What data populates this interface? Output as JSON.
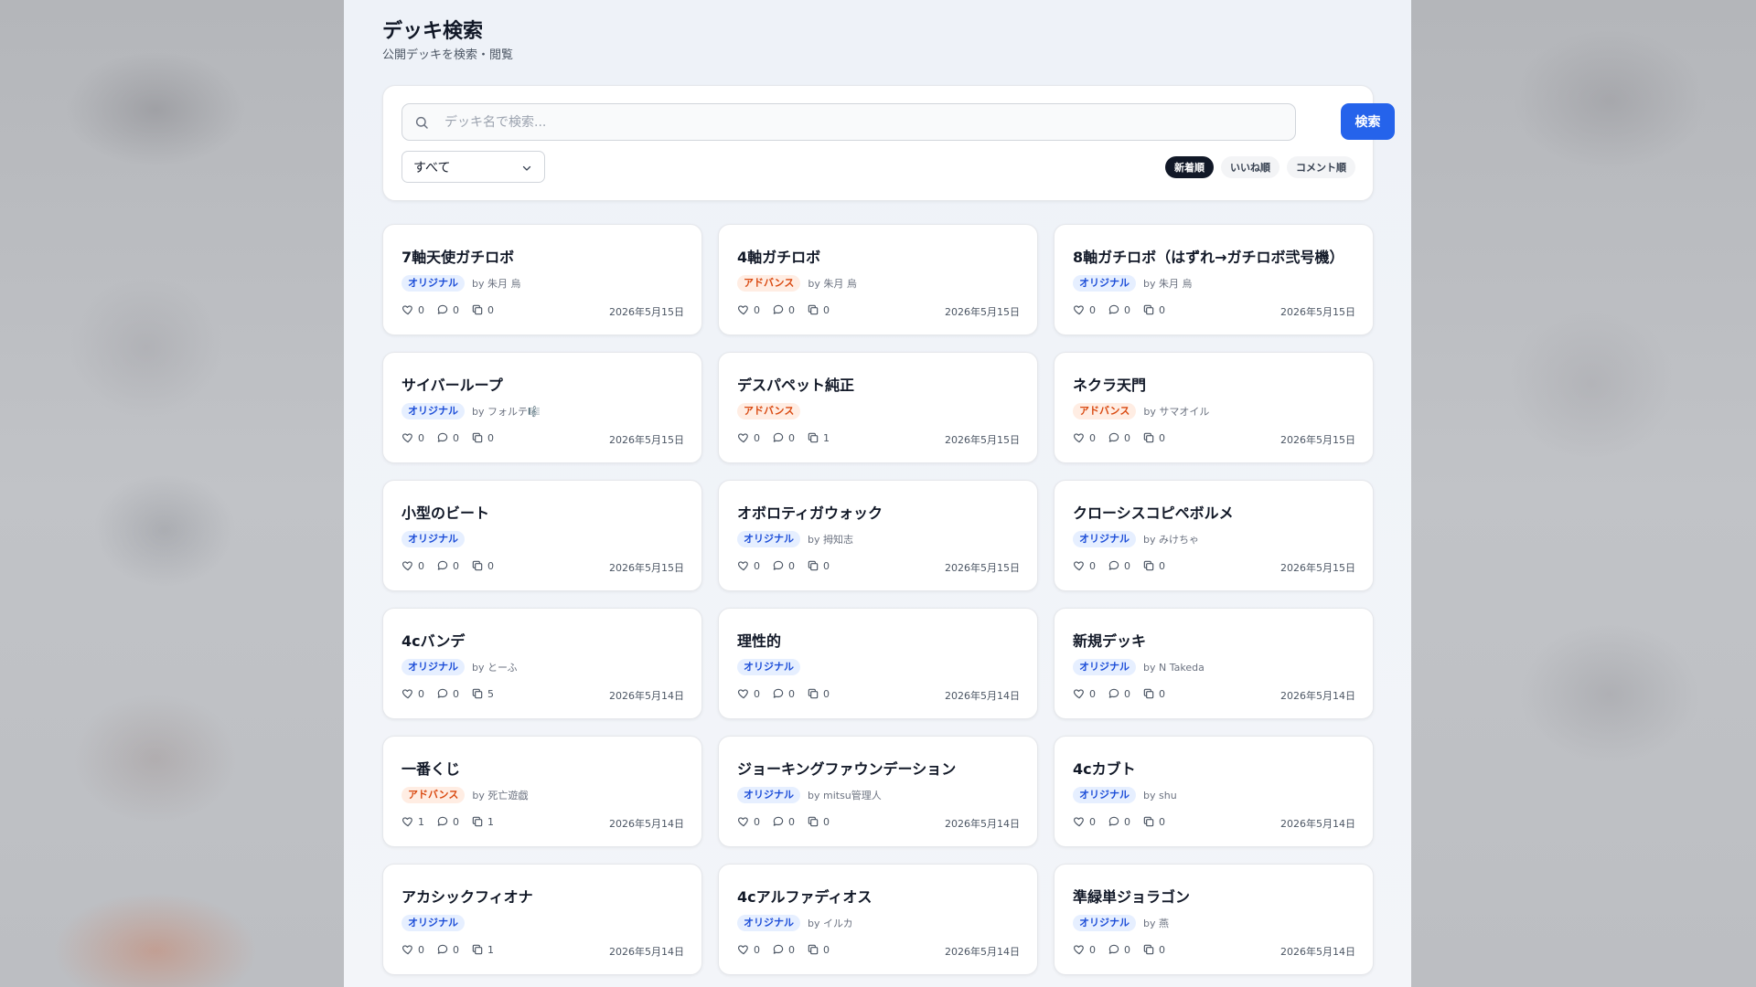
{
  "page": {
    "title": "デッキ検索",
    "subtitle": "公開デッキを検索・閲覧"
  },
  "search": {
    "placeholder": "デッキ名で検索...",
    "value": "",
    "button_label": "検索"
  },
  "filter": {
    "selected": "すべて"
  },
  "sort": {
    "options": [
      {
        "label": "新着順",
        "active": true
      },
      {
        "label": "いいね順",
        "active": false
      },
      {
        "label": "コメント順",
        "active": false
      }
    ]
  },
  "colors": {
    "accent": "#2563eb",
    "original_badge_bg": "#e6efff",
    "original_badge_text": "#1d4ed8",
    "advance_badge_bg": "#ffede3",
    "advance_badge_text": "#d9480f"
  },
  "decks": [
    {
      "name": "7軸天使ガチロボ",
      "badge": "オリジナル",
      "badge_type": "original",
      "author": "by 朱月 烏",
      "likes": "0",
      "comments": "0",
      "copies": "0",
      "date": "2026年5月15日"
    },
    {
      "name": "4軸ガチロボ",
      "badge": "アドバンス",
      "badge_type": "advance",
      "author": "by 朱月 烏",
      "likes": "0",
      "comments": "0",
      "copies": "0",
      "date": "2026年5月15日"
    },
    {
      "name": "8軸ガチロボ（はずれ→ガチロボ弐号機）",
      "badge": "オリジナル",
      "badge_type": "original",
      "author": "by 朱月 烏",
      "likes": "0",
      "comments": "0",
      "copies": "0",
      "date": "2026年5月15日"
    },
    {
      "name": "サイバーループ",
      "badge": "オリジナル",
      "badge_type": "original",
      "author": "by フォルテ🎼",
      "likes": "0",
      "comments": "0",
      "copies": "0",
      "date": "2026年5月15日"
    },
    {
      "name": "デスパペット純正",
      "badge": "アドバンス",
      "badge_type": "advance",
      "author": "",
      "likes": "0",
      "comments": "0",
      "copies": "1",
      "date": "2026年5月15日"
    },
    {
      "name": "ネクラ天門",
      "badge": "アドバンス",
      "badge_type": "advance",
      "author": "by サマオイル",
      "likes": "0",
      "comments": "0",
      "copies": "0",
      "date": "2026年5月15日"
    },
    {
      "name": "小型のビート",
      "badge": "オリジナル",
      "badge_type": "original",
      "author": "",
      "likes": "0",
      "comments": "0",
      "copies": "0",
      "date": "2026年5月15日"
    },
    {
      "name": "オボロティガウォック",
      "badge": "オリジナル",
      "badge_type": "original",
      "author": "by 拇知志",
      "likes": "0",
      "comments": "0",
      "copies": "0",
      "date": "2026年5月15日"
    },
    {
      "name": "クローシスコピペボルメ",
      "badge": "オリジナル",
      "badge_type": "original",
      "author": "by みけちゃ",
      "likes": "0",
      "comments": "0",
      "copies": "0",
      "date": "2026年5月15日"
    },
    {
      "name": "4cバンデ",
      "badge": "オリジナル",
      "badge_type": "original",
      "author": "by とーふ",
      "likes": "0",
      "comments": "0",
      "copies": "5",
      "date": "2026年5月14日"
    },
    {
      "name": "理性的",
      "badge": "オリジナル",
      "badge_type": "original",
      "author": "",
      "likes": "0",
      "comments": "0",
      "copies": "0",
      "date": "2026年5月14日"
    },
    {
      "name": "新規デッキ",
      "badge": "オリジナル",
      "badge_type": "original",
      "author": "by N Takeda",
      "likes": "0",
      "comments": "0",
      "copies": "0",
      "date": "2026年5月14日"
    },
    {
      "name": "一番くじ",
      "badge": "アドバンス",
      "badge_type": "advance",
      "author": "by 死亡遊戯",
      "likes": "1",
      "comments": "0",
      "copies": "1",
      "date": "2026年5月14日"
    },
    {
      "name": "ジョーキングファウンデーション",
      "badge": "オリジナル",
      "badge_type": "original",
      "author": "by mitsu管理人",
      "likes": "0",
      "comments": "0",
      "copies": "0",
      "date": "2026年5月14日"
    },
    {
      "name": "4cカブト",
      "badge": "オリジナル",
      "badge_type": "original",
      "author": "by shu",
      "likes": "0",
      "comments": "0",
      "copies": "0",
      "date": "2026年5月14日"
    },
    {
      "name": "アカシックフィオナ",
      "badge": "オリジナル",
      "badge_type": "original",
      "author": "",
      "likes": "0",
      "comments": "0",
      "copies": "1",
      "date": "2026年5月14日"
    },
    {
      "name": "4cアルファディオス",
      "badge": "オリジナル",
      "badge_type": "original",
      "author": "by イルカ",
      "likes": "0",
      "comments": "0",
      "copies": "0",
      "date": "2026年5月14日"
    },
    {
      "name": "準緑単ジョラゴン",
      "badge": "オリジナル",
      "badge_type": "original",
      "author": "by 燕",
      "likes": "0",
      "comments": "0",
      "copies": "0",
      "date": "2026年5月14日"
    }
  ]
}
